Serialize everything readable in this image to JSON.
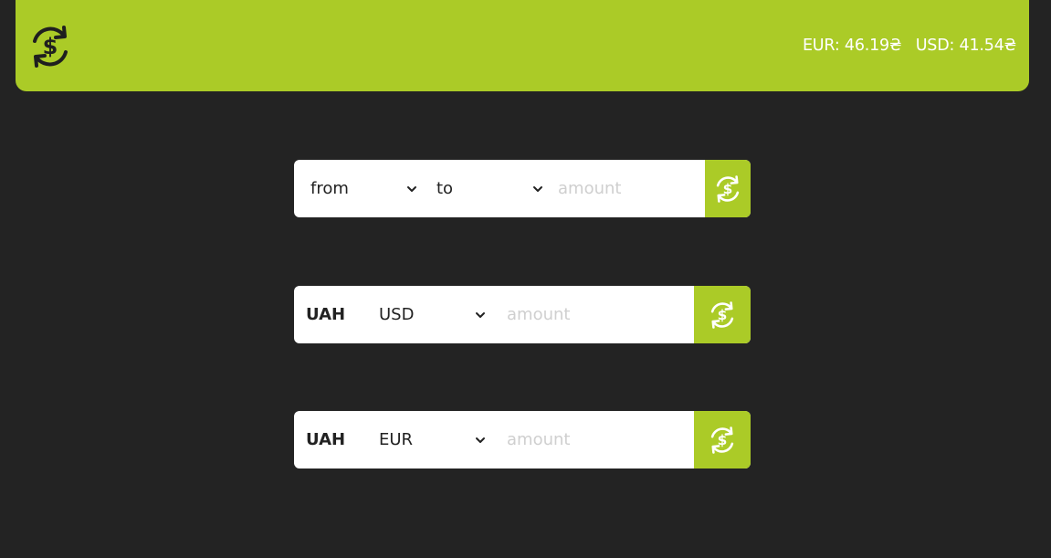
{
  "header": {
    "logo_icon": "currency-exchange-icon",
    "rates": [
      {
        "text": "EUR: 46.19₴"
      },
      {
        "text": "USD: 41.54₴"
      }
    ]
  },
  "converters": [
    {
      "from_select": "from",
      "to_select": "to",
      "amount_placeholder": "amount"
    },
    {
      "base_currency": "UAH",
      "target_select": "USD",
      "amount_placeholder": "amount"
    },
    {
      "base_currency": "UAH",
      "target_select": "EUR",
      "amount_placeholder": "amount"
    }
  ],
  "colors": {
    "accent": "#abcb27",
    "background": "#232323",
    "panel": "#ffffff",
    "placeholder": "#cfcfcf"
  }
}
